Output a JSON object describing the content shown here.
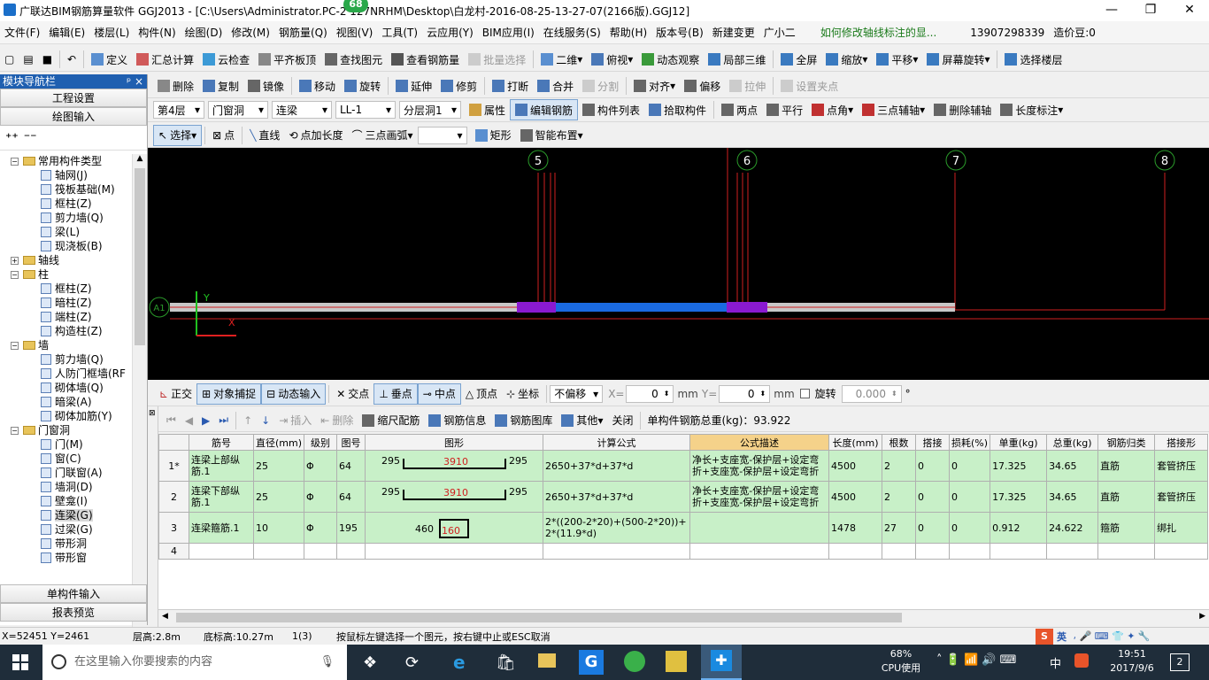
{
  "window": {
    "title": "广联达BIM钢筋算量软件 GGJ2013 - [C:\\Users\\Administrator.PC-2        127NRHM\\Desktop\\白龙村-2016-08-25-13-27-07(2166版).GGJ12]",
    "badge": "68",
    "controls": [
      "—",
      "❐",
      "✕"
    ]
  },
  "menu": {
    "items": [
      "文件(F)",
      "编辑(E)",
      "楼层(L)",
      "构件(N)",
      "绘图(D)",
      "修改(M)",
      "钢筋量(Q)",
      "视图(V)",
      "工具(T)",
      "云应用(Y)",
      "BIM应用(I)",
      "在线服务(S)",
      "帮助(H)",
      "版本号(B)",
      "新建变更",
      "广小二"
    ],
    "question": "如何修改轴线标注的显...",
    "phone": "13907298339",
    "beans": "造价豆:0"
  },
  "toolbar1": {
    "items": [
      "定义",
      "汇总计算",
      "云检查",
      "平齐板顶",
      "查找图元",
      "查看钢筋量",
      "批量选择",
      "二维",
      "俯视",
      "动态观察",
      "局部三维",
      "全屏",
      "缩放",
      "平移",
      "屏幕旋转",
      "选择楼层"
    ]
  },
  "toolbar2": {
    "items": [
      "删除",
      "复制",
      "镜像",
      "移动",
      "旋转",
      "延伸",
      "修剪",
      "打断",
      "合并",
      "分割",
      "对齐",
      "偏移",
      "拉伸",
      "设置夹点"
    ]
  },
  "toolbar3": {
    "floor": "第4层",
    "category": "门窗洞",
    "type": "连梁",
    "element": "LL-1",
    "layer": "分层洞1",
    "items": [
      "属性",
      "编辑钢筋",
      "构件列表",
      "拾取构件",
      "两点",
      "平行",
      "点角",
      "三点辅轴",
      "删除辅轴",
      "长度标注"
    ]
  },
  "toolbar4": {
    "items": [
      "选择",
      "点",
      "直线",
      "点加长度",
      "三点画弧",
      "矩形",
      "智能布置"
    ]
  },
  "nav": {
    "header": "模块导航栏",
    "pin": "ᵖ ×",
    "buttons": [
      "工程设置",
      "绘图输入"
    ],
    "bottom_buttons": [
      "单构件输入",
      "报表预览"
    ],
    "tree": [
      {
        "level": 0,
        "label": "常用构件类型",
        "folder": true,
        "open": true
      },
      {
        "level": 1,
        "label": "轴网(J)"
      },
      {
        "level": 1,
        "label": "筏板基础(M)"
      },
      {
        "level": 1,
        "label": "框柱(Z)"
      },
      {
        "level": 1,
        "label": "剪力墙(Q)"
      },
      {
        "level": 1,
        "label": "梁(L)"
      },
      {
        "level": 1,
        "label": "现浇板(B)"
      },
      {
        "level": 0,
        "label": "轴线",
        "folder": true,
        "open": false
      },
      {
        "level": 0,
        "label": "柱",
        "folder": true,
        "open": true
      },
      {
        "level": 1,
        "label": "框柱(Z)"
      },
      {
        "level": 1,
        "label": "暗柱(Z)"
      },
      {
        "level": 1,
        "label": "端柱(Z)"
      },
      {
        "level": 1,
        "label": "构造柱(Z)"
      },
      {
        "level": 0,
        "label": "墙",
        "folder": true,
        "open": true
      },
      {
        "level": 1,
        "label": "剪力墙(Q)"
      },
      {
        "level": 1,
        "label": "人防门框墙(RF"
      },
      {
        "level": 1,
        "label": "砌体墙(Q)"
      },
      {
        "level": 1,
        "label": "暗梁(A)"
      },
      {
        "level": 1,
        "label": "砌体加筋(Y)"
      },
      {
        "level": 0,
        "label": "门窗洞",
        "folder": true,
        "open": true
      },
      {
        "level": 1,
        "label": "门(M)"
      },
      {
        "level": 1,
        "label": "窗(C)"
      },
      {
        "level": 1,
        "label": "门联窗(A)"
      },
      {
        "level": 1,
        "label": "墙洞(D)"
      },
      {
        "level": 1,
        "label": "壁龛(I)"
      },
      {
        "level": 1,
        "label": "连梁(G)",
        "selected": true
      },
      {
        "level": 1,
        "label": "过梁(G)"
      },
      {
        "level": 1,
        "label": "带形洞"
      },
      {
        "level": 1,
        "label": "带形窗"
      }
    ]
  },
  "cad": {
    "axes": [
      "5",
      "6",
      "7",
      "8"
    ],
    "axis_a": "A1",
    "y_label": "Y",
    "x_label": "X"
  },
  "snapbar": {
    "items": [
      "正交",
      "对象捕捉",
      "动态输入",
      "交点",
      "垂点",
      "中点",
      "顶点",
      "坐标"
    ],
    "offset": "不偏移",
    "x_label": "X=",
    "x_value": "0",
    "mm1": "mm",
    "y_label": "Y=",
    "y_value": "0",
    "mm2": "mm",
    "rotate_label": "旋转",
    "rotate_value": "0.000",
    "deg": "°"
  },
  "rebarbar": {
    "items": [
      "插入",
      "删除",
      "缩尺配筋",
      "钢筋信息",
      "钢筋图库",
      "其他",
      "关闭"
    ],
    "total": "单构件钢筋总重(kg)：93.922"
  },
  "table": {
    "headers": [
      "",
      "筋号",
      "直径(mm)",
      "级别",
      "图号",
      "图形",
      "计算公式",
      "公式描述",
      "长度(mm)",
      "根数",
      "搭接",
      "损耗(%)",
      "单重(kg)",
      "总重(kg)",
      "钢筋归类",
      "搭接形"
    ],
    "rows": [
      {
        "num": "1*",
        "name": "连梁上部纵筋.1",
        "dia": "25",
        "grade": "Φ",
        "fig": "64",
        "shape_l": "295",
        "shape_m": "3910",
        "shape_r": "295",
        "formula": "2650+37*d+37*d",
        "desc": "净长+支座宽-保护层+设定弯折+支座宽-保护层+设定弯折",
        "len": "4500",
        "count": "2",
        "lap": "0",
        "loss": "0",
        "unit": "17.325",
        "total": "34.65",
        "cat": "直筋",
        "laptype": "套管挤压"
      },
      {
        "num": "2",
        "name": "连梁下部纵筋.1",
        "dia": "25",
        "grade": "Φ",
        "fig": "64",
        "shape_l": "295",
        "shape_m": "3910",
        "shape_r": "295",
        "formula": "2650+37*d+37*d",
        "desc": "净长+支座宽-保护层+设定弯折+支座宽-保护层+设定弯折",
        "len": "4500",
        "count": "2",
        "lap": "0",
        "loss": "0",
        "unit": "17.325",
        "total": "34.65",
        "cat": "直筋",
        "laptype": "套管挤压"
      },
      {
        "num": "3",
        "name": "连梁箍筋.1",
        "dia": "10",
        "grade": "Φ",
        "fig": "195",
        "shape_l": "460",
        "shape_m": "160",
        "shape_r": "",
        "formula": "2*((200-2*20)+(500-2*20))+2*(11.9*d)",
        "desc": "",
        "len": "1478",
        "count": "27",
        "lap": "0",
        "loss": "0",
        "unit": "0.912",
        "total": "24.622",
        "cat": "箍筋",
        "laptype": "绑扎"
      },
      {
        "num": "4",
        "name": "",
        "dia": "",
        "grade": "",
        "fig": "",
        "shape_l": "",
        "shape_m": "",
        "shape_r": "",
        "formula": "",
        "desc": "",
        "len": "",
        "count": "",
        "lap": "",
        "loss": "",
        "unit": "",
        "total": "",
        "cat": "",
        "laptype": ""
      }
    ]
  },
  "status": {
    "coords": "X=52451 Y=2461",
    "floor_h": "层高:2.8m",
    "bottom_h": "底标高:10.27m",
    "count": "1(3)",
    "hint": "按鼠标左键选择一个图元，按右键中止或ESC取消",
    "ime": "英"
  },
  "taskbar": {
    "search_placeholder": "在这里输入你要搜索的内容",
    "cpu": "68%",
    "cpu_label": "CPU使用",
    "lang": "中",
    "time": "19:51",
    "date": "2017/9/6",
    "notif": "2"
  }
}
